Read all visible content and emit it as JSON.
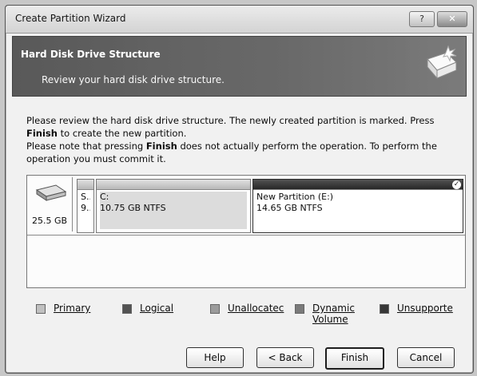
{
  "window": {
    "title": "Create Partition Wizard",
    "help_glyph": "?",
    "close_glyph": "✕"
  },
  "banner": {
    "title": "Hard Disk Drive Structure",
    "subtitle": "Review your hard disk drive structure."
  },
  "description": {
    "line1_a": "Please review the hard disk drive structure. The newly created partition is marked. Press ",
    "line1_bold": "Finish",
    "line1_b": " to create the new partition.",
    "line2_a": "Please note that pressing ",
    "line2_bold": "Finish",
    "line2_b": " does not actually perform the operation. To perform the operation you must commit it."
  },
  "disk": {
    "size": "25.5 GB",
    "partitions": [
      {
        "name": "S..",
        "info": "9.."
      },
      {
        "name": "C:",
        "info": "10.75 GB  NTFS"
      },
      {
        "name": "New Partition (E:)",
        "info": "14.65 GB  NTFS",
        "marked": true
      }
    ]
  },
  "legend": [
    {
      "label": "Primary",
      "color": "#bdbdbd"
    },
    {
      "label": "Logical",
      "color": "#555555"
    },
    {
      "label": "Unallocatec",
      "color": "#9a9a9a"
    },
    {
      "label": "Dynamic Volume",
      "color": "#7a7a7a"
    },
    {
      "label": "Unsupporte",
      "color": "#3a3a3a"
    }
  ],
  "buttons": {
    "help": "Help",
    "back": "< Back",
    "finish": "Finish",
    "cancel": "Cancel"
  }
}
